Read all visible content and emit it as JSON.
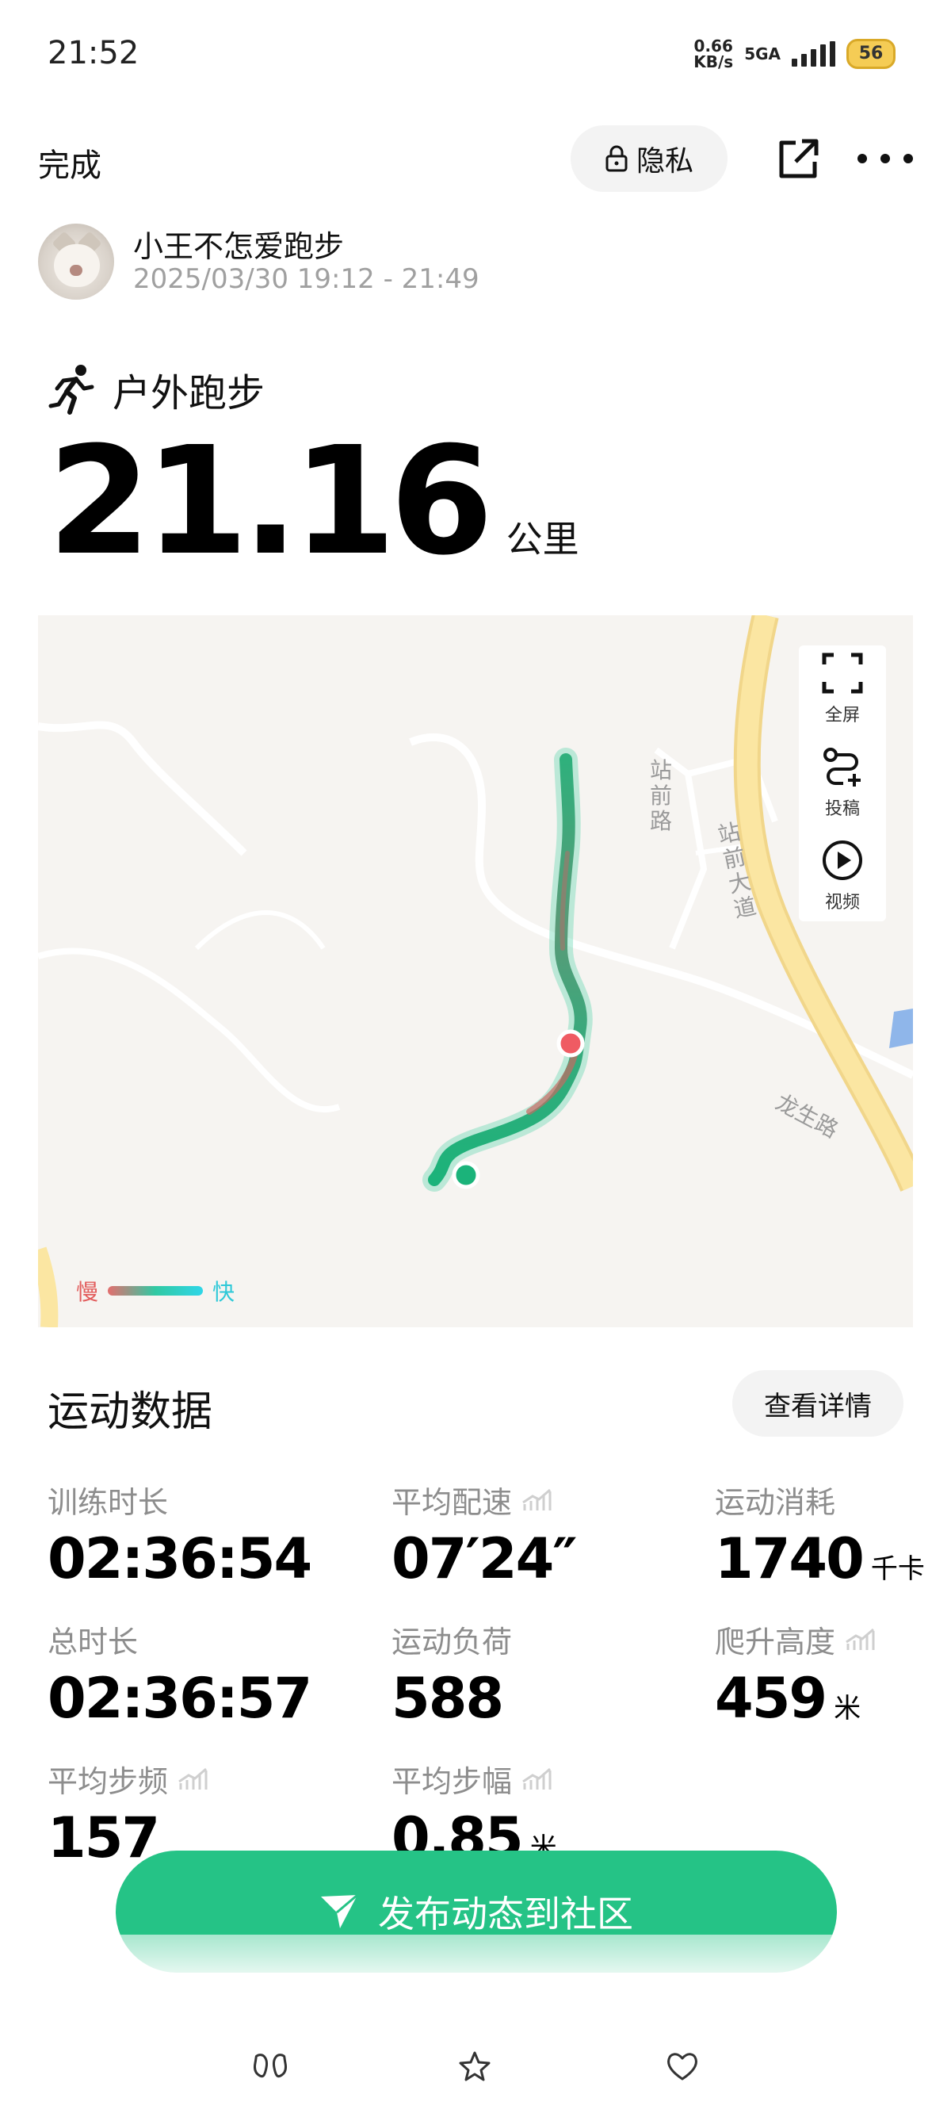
{
  "status_bar": {
    "time": "21:52",
    "net_speed_value": "0.66",
    "net_speed_unit": "KB/s",
    "network": "5GA",
    "battery": "56"
  },
  "header": {
    "done": "完成",
    "privacy": "隐私"
  },
  "user": {
    "name": "小王不怎爱跑步",
    "time_range": "2025/03/30 19:12 - 21:49"
  },
  "workout": {
    "type": "户外跑步",
    "distance": "21.16",
    "distance_unit": "公里"
  },
  "map": {
    "controls": {
      "fullscreen": "全屏",
      "submit": "投稿",
      "video": "视频"
    },
    "legend": {
      "slow": "慢",
      "fast": "快"
    },
    "roads": {
      "zhanqian_road": "站前路",
      "zhanqian_avenue": "站前大道",
      "longsheng_road": "龙生路"
    }
  },
  "stats": {
    "title": "运动数据",
    "details_button": "查看详情",
    "items": [
      {
        "label": "训练时长",
        "value": "02:36:54",
        "unit": "",
        "has_chart_icon": false
      },
      {
        "label": "平均配速",
        "value": "07′24″",
        "unit": "",
        "has_chart_icon": true
      },
      {
        "label": "运动消耗",
        "value": "1740",
        "unit": "千卡",
        "has_chart_icon": false
      },
      {
        "label": "总时长",
        "value": "02:36:57",
        "unit": "",
        "has_chart_icon": false
      },
      {
        "label": "运动负荷",
        "value": "588",
        "unit": "",
        "has_chart_icon": false
      },
      {
        "label": "爬升高度",
        "value": "459",
        "unit": "米",
        "has_chart_icon": true
      },
      {
        "label": "平均步频",
        "value": "157",
        "unit": "",
        "has_chart_icon": true
      },
      {
        "label": "平均步幅",
        "value": "0.85",
        "unit": "米",
        "has_chart_icon": true
      }
    ]
  },
  "publish_button": "发布动态到社区",
  "colors": {
    "accent": "#25c386",
    "route_start": "#1bb37a",
    "route_end": "#ef5b63"
  }
}
